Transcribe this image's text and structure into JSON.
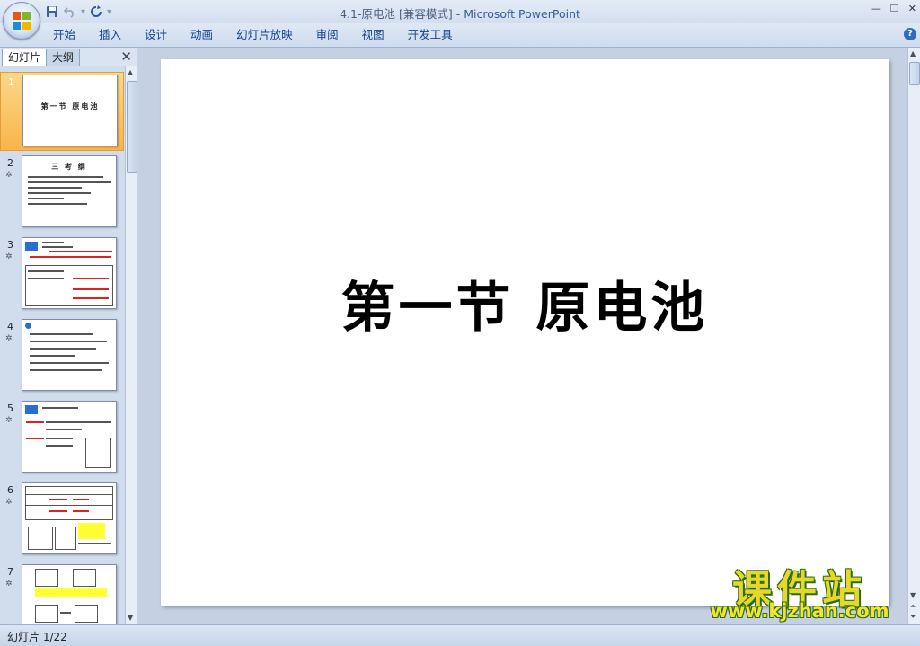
{
  "window": {
    "title_doc": "4.1-原电池 [兼容模式]",
    "title_sep": " - ",
    "title_app": "Microsoft PowerPoint"
  },
  "ribbon": {
    "tabs": [
      "开始",
      "插入",
      "设计",
      "动画",
      "幻灯片放映",
      "审阅",
      "视图",
      "开发工具"
    ]
  },
  "left_pane": {
    "tab_slides": "幻灯片",
    "tab_outline": "大纲",
    "thumbnails": [
      {
        "num": "1",
        "title": "第一节 原电池"
      },
      {
        "num": "2",
        "title": "三 考 纲"
      },
      {
        "num": "3"
      },
      {
        "num": "4"
      },
      {
        "num": "5"
      },
      {
        "num": "6"
      },
      {
        "num": "7"
      }
    ]
  },
  "slide": {
    "title": "第一节  原电池"
  },
  "watermark": {
    "cn": "课件站",
    "url": "www.kjzhan.com"
  },
  "status": {
    "text": "幻灯片 1/22"
  },
  "colors": {
    "ribbon_text": "#15428b",
    "selected_thumb": "#f8b54a",
    "watermark_yellow": "#e6d82a",
    "watermark_green": "#2c6b12"
  }
}
